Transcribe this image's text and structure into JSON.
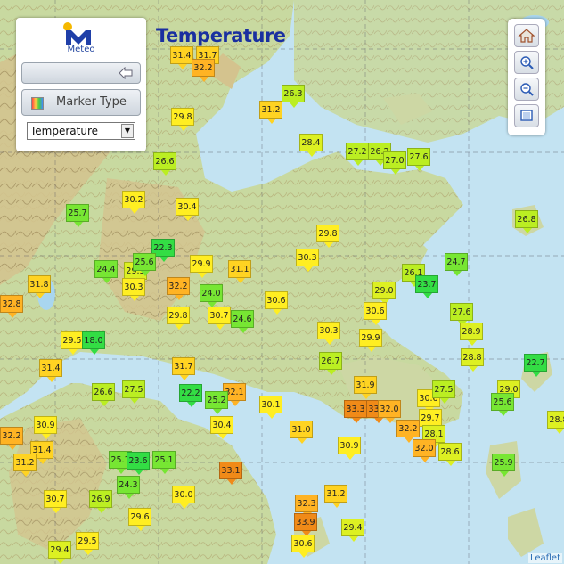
{
  "title": "Temperature",
  "logo_text": "Meteo",
  "marker_type_label": "Marker Type",
  "select_value": "Temperature",
  "attribution": "Leaflet",
  "icons": [
    "home-icon",
    "zoom-in-icon",
    "zoom-out-icon",
    "fullscreen-icon",
    "back-arrow-icon",
    "color-palette-icon"
  ],
  "colors": {
    "green": "#44dd33",
    "lime": "#bbee22",
    "yellow": "#ffee22",
    "orange": "#ffaa22",
    "red-orange": "#ee7711"
  },
  "stations": [
    {
      "v": "31.4"
    },
    {
      "v": "31.7"
    },
    {
      "v": "32.2"
    },
    {
      "v": "26.3"
    },
    {
      "v": "31.2"
    },
    {
      "v": "29.8"
    },
    {
      "v": "28.4"
    },
    {
      "v": "26.6"
    },
    {
      "v": "27.2"
    },
    {
      "v": "26.2"
    },
    {
      "v": "27.0"
    },
    {
      "v": "27.6"
    },
    {
      "v": "25.7"
    },
    {
      "v": "30.2"
    },
    {
      "v": "30.4"
    },
    {
      "v": "26.8"
    },
    {
      "v": "22.3"
    },
    {
      "v": "29.8"
    },
    {
      "v": "24.4"
    },
    {
      "v": "29.3"
    },
    {
      "v": "25.6"
    },
    {
      "v": "29.9"
    },
    {
      "v": "31.1"
    },
    {
      "v": "30.3"
    },
    {
      "v": "26.1"
    },
    {
      "v": "24.7"
    },
    {
      "v": "31.8"
    },
    {
      "v": "30.3"
    },
    {
      "v": "32.2"
    },
    {
      "v": "24.0"
    },
    {
      "v": "23.7"
    },
    {
      "v": "30.6"
    },
    {
      "v": "29.0"
    },
    {
      "v": "32.8"
    },
    {
      "v": "29.8"
    },
    {
      "v": "30.7"
    },
    {
      "v": "24.6"
    },
    {
      "v": "30.6"
    },
    {
      "v": "27.6"
    },
    {
      "v": "29.5"
    },
    {
      "v": "18.0"
    },
    {
      "v": "30.3"
    },
    {
      "v": "29.9"
    },
    {
      "v": "28.9"
    },
    {
      "v": "31.4"
    },
    {
      "v": "31.7"
    },
    {
      "v": "26.7"
    },
    {
      "v": "28.8"
    },
    {
      "v": "22.7"
    },
    {
      "v": "26.6"
    },
    {
      "v": "27.5"
    },
    {
      "v": "22.2"
    },
    {
      "v": "32.1"
    },
    {
      "v": "31.9"
    },
    {
      "v": "25.2"
    },
    {
      "v": "30.1"
    },
    {
      "v": "30.6"
    },
    {
      "v": "27.5"
    },
    {
      "v": "29.0"
    },
    {
      "v": "25.6"
    },
    {
      "v": "33.3"
    },
    {
      "v": "33.1"
    },
    {
      "v": "32.0"
    },
    {
      "v": "29.7"
    },
    {
      "v": "28.1"
    },
    {
      "v": "32.2"
    },
    {
      "v": "32.0"
    },
    {
      "v": "30.9"
    },
    {
      "v": "30.4"
    },
    {
      "v": "31.0"
    },
    {
      "v": "31.4"
    },
    {
      "v": "31.2"
    },
    {
      "v": "25.1"
    },
    {
      "v": "23.6"
    },
    {
      "v": "25.1"
    },
    {
      "v": "28.6"
    },
    {
      "v": "24.3"
    },
    {
      "v": "33.1"
    },
    {
      "v": "25.9"
    },
    {
      "v": "30.0"
    },
    {
      "v": "30.7"
    },
    {
      "v": "26.9"
    },
    {
      "v": "29.6"
    },
    {
      "v": "32.3"
    },
    {
      "v": "31.2"
    },
    {
      "v": "33.9"
    },
    {
      "v": "29.4"
    },
    {
      "v": "29.4"
    },
    {
      "v": "29.5"
    },
    {
      "v": "30.6"
    },
    {
      "v": "30.9"
    },
    {
      "v": "32.2"
    },
    {
      "v": "28.8"
    }
  ]
}
